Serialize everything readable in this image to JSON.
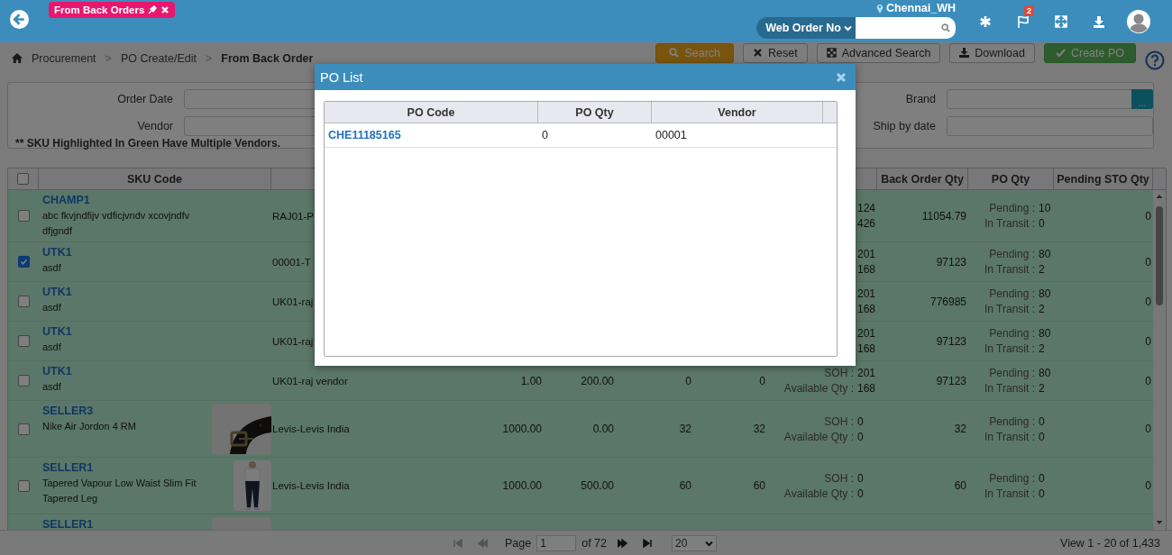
{
  "header": {
    "tag": {
      "label": "From Back Orders",
      "pinned": true
    },
    "location": "Chennai_WH",
    "search": {
      "scope": "Web Order No"
    },
    "notifications": "2"
  },
  "breadcrumb": [
    {
      "label": "Procurement",
      "current": false
    },
    {
      "separator": ">",
      "label": "PO Create/Edit",
      "current": false
    },
    {
      "separator": ">",
      "label": "From Back Order",
      "current": true
    }
  ],
  "toolbar": [
    {
      "label": "Search",
      "kind": "primary"
    },
    {
      "label": "Reset",
      "kind": "reset"
    },
    {
      "label": "Advanced Search",
      "kind": "advanced"
    },
    {
      "label": "Download",
      "kind": "download"
    },
    {
      "label": "Create PO",
      "kind": "create"
    }
  ],
  "filters": {
    "left": [
      {
        "label": "Order Date"
      },
      {
        "label": "Vendor"
      }
    ],
    "right": [
      {
        "label": "Brand",
        "lookup": "..."
      },
      {
        "label": "Ship by date"
      }
    ],
    "note": "** SKU Highlighted In Green Have Multiple Vendors."
  },
  "table": {
    "all_checked": false,
    "headers": {
      "sku": "SKU Code",
      "back_order": "Back Order Qty",
      "po_qty": "PO Qty",
      "pending_sto": "Pending STO Qty"
    },
    "rows": [
      {
        "checked": false,
        "highlighted": true,
        "sku": "CHAMP1",
        "description": "abc fkvjndfijv vdficjvndv xcovjndfv dfjgndf",
        "vendor": "RAJ01-P",
        "stock": [
          {
            "value": "124"
          },
          {
            "value": "426"
          }
        ],
        "back_order": "11054.79",
        "po": [
          {
            "label": "Pending :",
            "value": "10"
          },
          {
            "label": "In Transit :",
            "value": "0"
          }
        ],
        "pending_sto": "0"
      },
      {
        "checked": true,
        "highlighted": true,
        "sku": "UTK1",
        "description": "asdf",
        "vendor": "00001-T",
        "stock": [
          {
            "value": "201"
          },
          {
            "value": "168"
          }
        ],
        "back_order": "97123",
        "po": [
          {
            "label": "Pending :",
            "value": "80"
          },
          {
            "label": "In Transit :",
            "value": "2"
          }
        ],
        "pending_sto": "0"
      },
      {
        "checked": false,
        "highlighted": true,
        "sku": "UTK1",
        "description": "asdf",
        "vendor": "UK01-raj",
        "stock": [
          {
            "value": "201"
          },
          {
            "value": "168"
          }
        ],
        "back_order": "776985",
        "po": [
          {
            "label": "Pending :",
            "value": "80"
          },
          {
            "label": "In Transit :",
            "value": "2"
          }
        ],
        "pending_sto": "0"
      },
      {
        "checked": false,
        "highlighted": true,
        "sku": "UTK1",
        "description": "asdf",
        "vendor": "UK01-raj",
        "stock": [
          {
            "value": "201"
          },
          {
            "value": "168"
          }
        ],
        "back_order": "97123",
        "po": [
          {
            "label": "Pending :",
            "value": "80"
          },
          {
            "label": "In Transit :",
            "value": "2"
          }
        ],
        "pending_sto": "0"
      },
      {
        "checked": false,
        "highlighted": true,
        "sku": "UTK1",
        "description": "asdf",
        "vendor": "UK01-raj vendor",
        "column_4": "1.00",
        "column_5": "200.00",
        "column_6": "0",
        "column_7": "0",
        "stock": [
          {
            "label": "SOH :",
            "value": "201"
          },
          {
            "label": "Available Qty :",
            "value": "168"
          }
        ],
        "back_order": "97123",
        "po": [
          {
            "label": "Pending :",
            "value": "80"
          },
          {
            "label": "In Transit :",
            "value": "2"
          }
        ],
        "pending_sto": "0"
      },
      {
        "checked": false,
        "highlighted": true,
        "sku": "SELLER3",
        "description": "Nike Air Jordon 4 RM",
        "thumbnail": {
          "kind": "picture"
        },
        "vendor": "Levis-Levis India",
        "column_4": "1000.00",
        "column_5": "0.00",
        "column_6": "32",
        "column_7": "32",
        "stock": [
          {
            "label": "SOH :",
            "value": "0"
          },
          {
            "label": "Available Qty :",
            "value": "0"
          }
        ],
        "back_order": "32",
        "po": [
          {
            "label": "Pending :",
            "value": "0"
          },
          {
            "label": "In Transit :",
            "value": "0"
          }
        ],
        "pending_sto": "0"
      },
      {
        "checked": false,
        "highlighted": true,
        "sku": "SELLER1",
        "description": "Tapered Vapour Low Waist Slim Fit Tapered Leg",
        "thumbnail": {
          "kind": "picture"
        },
        "vendor": "Levis-Levis India",
        "column_4": "1000.00",
        "column_5": "500.00",
        "column_6": "60",
        "column_7": "60",
        "stock": [
          {
            "label": "SOH :",
            "value": "0"
          },
          {
            "label": "Available Qty :",
            "value": "0"
          }
        ],
        "back_order": "60",
        "po": [
          {
            "label": "Pending :",
            "value": "0"
          },
          {
            "label": "In Transit :",
            "value": "0"
          }
        ],
        "pending_sto": "0"
      },
      {
        "highlighted": true,
        "sku": "SELLER1",
        "thumbnail": {
          "kind": "picture"
        }
      }
    ]
  },
  "pager": {
    "nav": [
      {
        "kind": "first",
        "disabled": true
      },
      {
        "kind": "prev",
        "disabled": true
      },
      {
        "kind": "next",
        "disabled": false
      },
      {
        "kind": "last",
        "disabled": false
      }
    ],
    "page_label": "Page",
    "page": "1",
    "total": "of 72",
    "page_size": "20",
    "summary": "View 1 - 20 of 1,433"
  },
  "modal": {
    "title": "PO List",
    "columns": [
      "PO Code",
      "PO Qty",
      "Vendor"
    ],
    "rows": [
      [
        "CHE11185165",
        "0",
        "00001"
      ]
    ]
  }
}
